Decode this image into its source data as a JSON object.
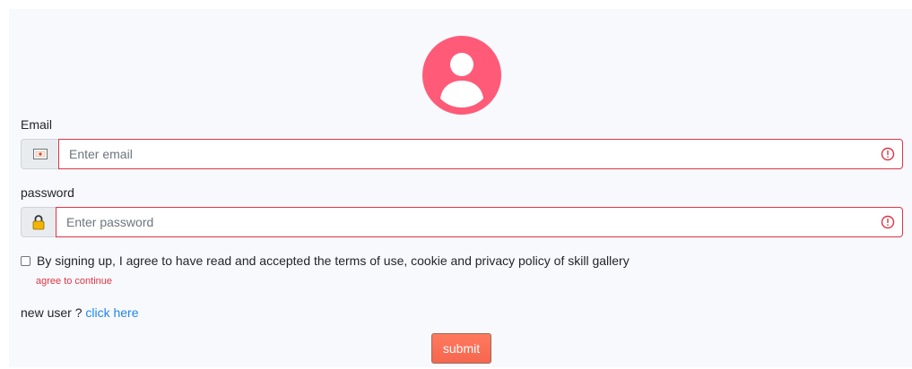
{
  "form": {
    "email_label": "Email",
    "email_placeholder": "Enter email",
    "password_label": "password",
    "password_placeholder": "Enter password",
    "terms_text": "By signing up, I agree to have read and accepted the terms of use, cookie and privacy policy of skill gallery",
    "terms_error": "agree to continue",
    "terms_checked": false,
    "new_user_prefix": "new user ?",
    "new_user_link": "click here",
    "submit_label": "submit"
  },
  "icons": {
    "avatar": "user-circle-icon",
    "email_addon": "envelope-icon",
    "password_addon": "lock-icon",
    "validation": "exclamation-circle-icon"
  },
  "colors": {
    "avatar": "#ff5a78",
    "error": "#dc3545",
    "link": "#1e88e5",
    "submit_background": "#f6664f",
    "panel_background": "#f8f9fd"
  }
}
